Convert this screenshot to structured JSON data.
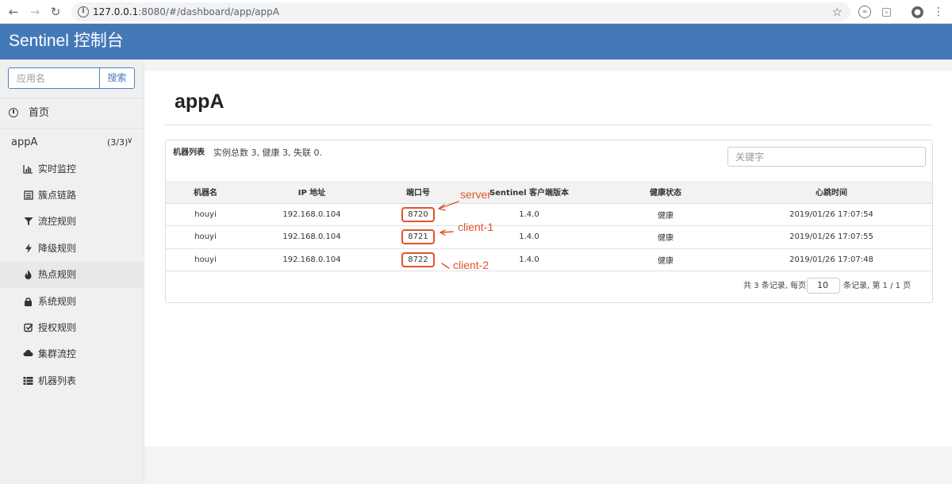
{
  "browser": {
    "url_host": "127.0.0.1",
    "url_rest": ":8080/#/dashboard/app/appA",
    "icons": [
      "back-arrow-icon",
      "forward-arrow-icon",
      "reload-icon",
      "info-icon",
      "star-icon",
      "extension-icon",
      "profile-icon",
      "menu-icon"
    ]
  },
  "header": {
    "title": "Sentinel 控制台"
  },
  "sidebar": {
    "search_placeholder": "应用名",
    "search_button": "搜索",
    "home_label": "首页",
    "app": {
      "name": "appA",
      "count": "(3/3)"
    },
    "items": [
      {
        "label": "实时监控",
        "icon": "bar-chart-icon"
      },
      {
        "label": "簇点链路",
        "icon": "list-icon"
      },
      {
        "label": "流控规则",
        "icon": "filter-icon"
      },
      {
        "label": "降级规则",
        "icon": "flash-icon"
      },
      {
        "label": "热点规则",
        "icon": "fire-icon"
      },
      {
        "label": "系统规则",
        "icon": "lock-icon"
      },
      {
        "label": "授权规则",
        "icon": "check-square-icon"
      },
      {
        "label": "集群流控",
        "icon": "cloud-icon"
      },
      {
        "label": "机器列表",
        "icon": "th-list-icon"
      }
    ]
  },
  "main": {
    "title": "appA",
    "panel": {
      "title": "机器列表",
      "summary": "实例总数 3, 健康 3, 失联 0.",
      "keyword_placeholder": "关键字",
      "columns": [
        "机器名",
        "IP 地址",
        "端口号",
        "Sentinel 客户端版本",
        "健康状态",
        "心跳时间"
      ],
      "rows": [
        {
          "host": "houyi",
          "ip": "192.168.0.104",
          "port": "8720",
          "version": "1.4.0",
          "health": "健康",
          "heartbeat": "2019/01/26 17:07:54"
        },
        {
          "host": "houyi",
          "ip": "192.168.0.104",
          "port": "8721",
          "version": "1.4.0",
          "health": "健康",
          "heartbeat": "2019/01/26 17:07:55"
        },
        {
          "host": "houyi",
          "ip": "192.168.0.104",
          "port": "8722",
          "version": "1.4.0",
          "health": "健康",
          "heartbeat": "2019/01/26 17:07:48"
        }
      ],
      "pager": {
        "prefix": "共 3 条记录, 每页",
        "page_size": "10",
        "suffix": "条记录, 第 1 / 1 页"
      }
    }
  },
  "annotations": {
    "color": "#e0542d",
    "labels": [
      "server",
      "client-1",
      "client-2"
    ]
  },
  "colors": {
    "header": "#4479b8",
    "annotation": "#e0542d"
  }
}
